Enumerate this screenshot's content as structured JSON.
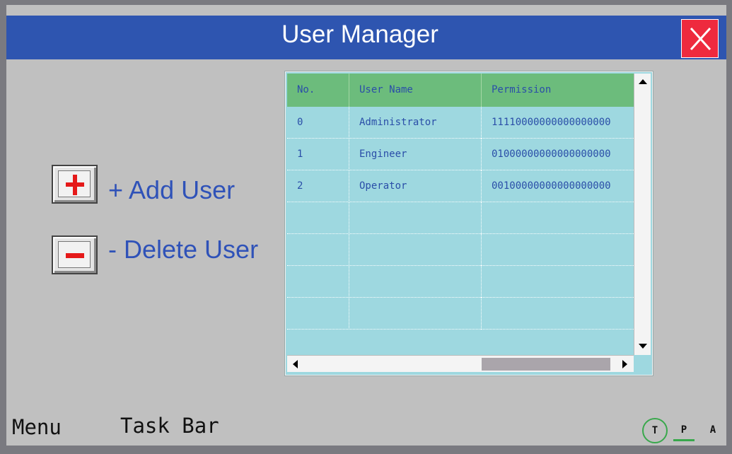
{
  "window": {
    "title": "User Manager",
    "close_icon": "close-x-icon"
  },
  "actions": {
    "add_label": "+ Add User",
    "delete_label": "- Delete User",
    "add_icon": "plus-icon",
    "delete_icon": "minus-icon"
  },
  "table": {
    "columns": [
      "No.",
      "User Name",
      "Permission"
    ],
    "rows": [
      [
        "0",
        "Administrator",
        "11110000000000000000"
      ],
      [
        "1",
        "Engineer",
        "01000000000000000000"
      ],
      [
        "2",
        "Operator",
        "00100000000000000000"
      ],
      [
        "",
        "",
        ""
      ],
      [
        "",
        "",
        ""
      ],
      [
        "",
        "",
        ""
      ],
      [
        "",
        "",
        ""
      ]
    ]
  },
  "bottom": {
    "menu_label": "Menu",
    "taskbar_label": "Task Bar",
    "status": [
      "T",
      "P",
      "A"
    ]
  },
  "colors": {
    "titlebar": "#2e55b0",
    "close_button": "#ee2a3e",
    "table_header": "#6cbc7c",
    "table_body": "#9ed8e0",
    "text_blue": "#2a4ea8",
    "status_green": "#39a84c"
  }
}
